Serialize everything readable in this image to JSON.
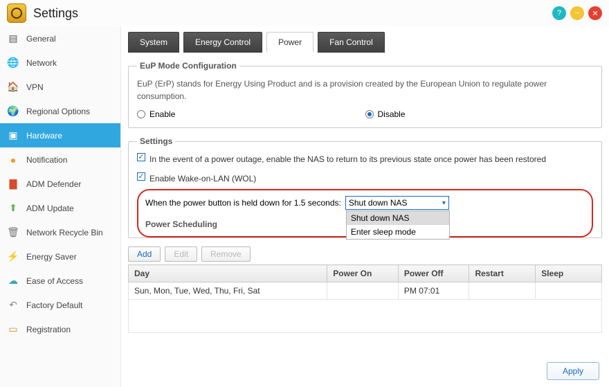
{
  "window": {
    "title": "Settings"
  },
  "sidebar": {
    "items": [
      {
        "label": "General",
        "icon": "sliders-icon"
      },
      {
        "label": "Network",
        "icon": "globe-icon"
      },
      {
        "label": "VPN",
        "icon": "house-icon"
      },
      {
        "label": "Regional Options",
        "icon": "globe-pin-icon"
      },
      {
        "label": "Hardware",
        "icon": "chip-icon",
        "active": true
      },
      {
        "label": "Notification",
        "icon": "alert-icon"
      },
      {
        "label": "ADM Defender",
        "icon": "firewall-icon"
      },
      {
        "label": "ADM Update",
        "icon": "upload-icon"
      },
      {
        "label": "Network Recycle Bin",
        "icon": "trash-icon"
      },
      {
        "label": "Energy Saver",
        "icon": "bolt-icon"
      },
      {
        "label": "Ease of Access",
        "icon": "cloud-download-icon"
      },
      {
        "label": "Factory Default",
        "icon": "undo-icon"
      },
      {
        "label": "Registration",
        "icon": "form-icon"
      }
    ]
  },
  "tabs": [
    {
      "label": "System"
    },
    {
      "label": "Energy Control"
    },
    {
      "label": "Power",
      "active": true
    },
    {
      "label": "Fan Control"
    }
  ],
  "eup": {
    "legend": "EuP Mode Configuration",
    "desc": "EuP (ErP) stands for Energy Using Product and is a provision created by the European Union to regulate power consumption.",
    "enable_label": "Enable",
    "disable_label": "Disable",
    "value": "Disable"
  },
  "settings": {
    "legend": "Settings",
    "chk_outage": "In the event of a power outage, enable the NAS to return to its previous state once power has been restored",
    "chk_outage_checked": true,
    "chk_wol": "Enable Wake-on-LAN (WOL)",
    "chk_wol_checked": true,
    "power_button_label": "When the power button is held down for 1.5 seconds:",
    "power_button_value": "Shut down NAS",
    "power_button_options": [
      "Shut down NAS",
      "Enter sleep mode"
    ]
  },
  "power_sched": {
    "legend": "Power Scheduling",
    "buttons": {
      "add": "Add",
      "edit": "Edit",
      "remove": "Remove"
    },
    "columns": [
      "Day",
      "Power On",
      "Power Off",
      "Restart",
      "Sleep"
    ],
    "rows": [
      {
        "day": "Sun, Mon, Tue, Wed, Thu, Fri, Sat",
        "power_on": "",
        "power_off": "PM 07:01",
        "restart": "",
        "sleep": ""
      }
    ]
  },
  "apply_label": "Apply"
}
